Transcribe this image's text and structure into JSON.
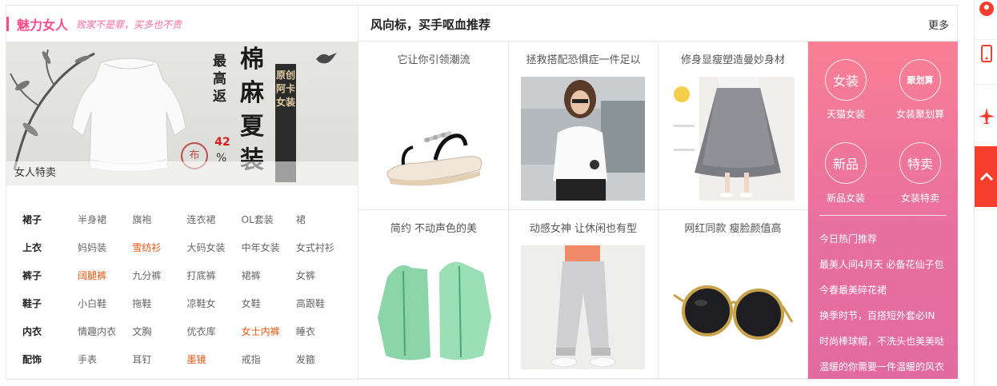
{
  "left": {
    "title": "魅力女人",
    "slogan": "败家不是罪，买多也不贵",
    "banner": {
      "vertical_text": "最高返",
      "discount": "42",
      "percent": "%",
      "big_text": "棉麻夏装",
      "stamp_text": "原创阿卡女装",
      "seal": "布",
      "caption": "女人特卖"
    },
    "categories": [
      {
        "head": "裙子",
        "items": [
          "半身裙",
          "旗袍",
          "连衣裙",
          "OL套装",
          "裙"
        ],
        "hot": []
      },
      {
        "head": "上衣",
        "items": [
          "妈妈装",
          "雪纺衫",
          "大码女装",
          "中年女装",
          "女式衬衫"
        ],
        "hot": [
          1
        ]
      },
      {
        "head": "裤子",
        "items": [
          "阔腿裤",
          "九分裤",
          "打底裤",
          "裙裤",
          "女裤"
        ],
        "hot": [
          0
        ]
      },
      {
        "head": "鞋子",
        "items": [
          "小白鞋",
          "拖鞋",
          "凉鞋女",
          "女鞋",
          "高跟鞋"
        ],
        "hot": []
      },
      {
        "head": "内衣",
        "items": [
          "情趣内衣",
          "文胸",
          "优衣库",
          "女士内裤",
          "睡衣"
        ],
        "hot": [
          3
        ]
      },
      {
        "head": "配饰",
        "items": [
          "手表",
          "耳钉",
          "墨镜",
          "戒指",
          "发箍"
        ],
        "hot": [
          2
        ]
      }
    ]
  },
  "middle": {
    "title": "风向标，买手呕血推荐",
    "more": "更多",
    "products": [
      {
        "title": "它让你引领潮流",
        "image": "sandal"
      },
      {
        "title": "拯救搭配恐惧症一件足以",
        "image": "white-tee-model"
      },
      {
        "title": "修身显瘦塑造曼妙身材",
        "image": "tulle-skirt"
      },
      {
        "title": "简约 不动声色的美",
        "image": "green-sun-jacket"
      },
      {
        "title": "动感女神 让休闲也有型",
        "image": "jogger-pants"
      },
      {
        "title": "网红同款 瘦脸颜值高",
        "image": "sunglasses"
      }
    ]
  },
  "pink": {
    "circles": [
      {
        "text": "女装",
        "label": "天猫女装"
      },
      {
        "text": "聚划算",
        "label": "女装聚划算"
      },
      {
        "text": "新品",
        "label": "新品女装"
      },
      {
        "text": "特卖",
        "label": "女装特卖"
      }
    ],
    "hot_title": "今日热门推荐",
    "hot_items": [
      "最美人间4月天 必备花仙子包",
      "今春最美碎花裙",
      "换季时节，百搭短外套必IN",
      "时尚棒球帽，不洗头也美美哒",
      "温暖的你需要一件温暖的风衣"
    ]
  },
  "side": {
    "icons": [
      "user-icon",
      "phone-icon",
      "plane-icon",
      "back-to-top-icon"
    ],
    "colors": {
      "accent": "#f53e2d",
      "pink": "#ff4a8a"
    }
  }
}
